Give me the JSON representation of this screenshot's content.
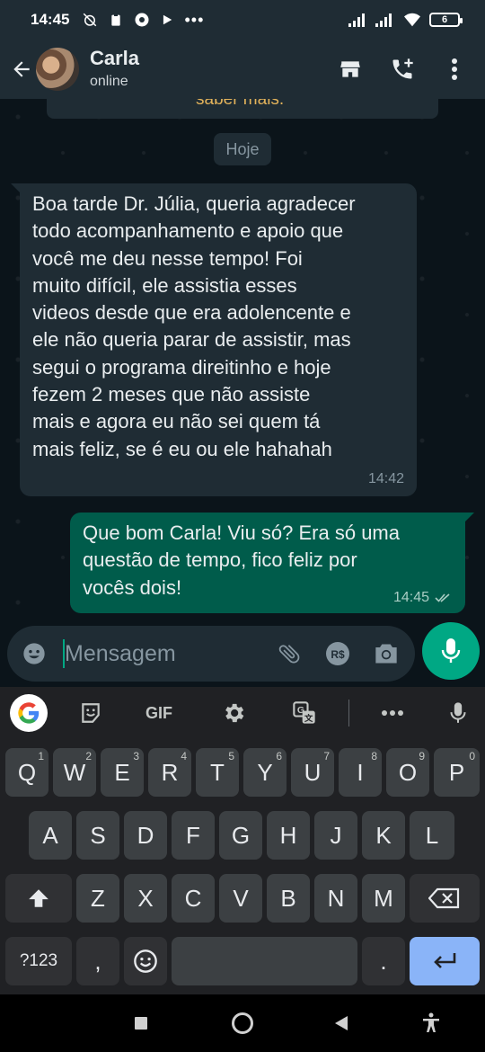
{
  "status_bar": {
    "time": "14:45",
    "battery": "6"
  },
  "header": {
    "contact_name": "Carla",
    "contact_status": "online"
  },
  "chat": {
    "previous_message_fragment": "saber mais.",
    "date_chip": "Hoje",
    "messages": [
      {
        "direction": "incoming",
        "lines": [
          "Boa tarde Dr. Júlia, queria agradecer",
          "todo acompanhamento e apoio que",
          "você me deu nesse tempo! Foi",
          "muito difícil, ele assistia esses",
          "videos desde que era adolencente e",
          "ele não queria parar de assistir, mas",
          "segui o programa direitinho e hoje",
          "fezem 2 meses que não assiste",
          "mais e agora eu não sei quem tá",
          "mais feliz, se é eu ou ele hahahah"
        ],
        "time": "14:42"
      },
      {
        "direction": "outgoing",
        "lines": [
          "Que bom Carla! Viu só? Era só uma",
          "questão de tempo, fico feliz por",
          "vocês dois!"
        ],
        "time": "14:45",
        "status": "read"
      }
    ]
  },
  "composer": {
    "placeholder": "Mensagem",
    "value": ""
  },
  "keyboard": {
    "toolbar": {
      "gif_label": "GIF"
    },
    "row1": [
      {
        "key": "Q",
        "hint": "1"
      },
      {
        "key": "W",
        "hint": "2"
      },
      {
        "key": "E",
        "hint": "3"
      },
      {
        "key": "R",
        "hint": "4"
      },
      {
        "key": "T",
        "hint": "5"
      },
      {
        "key": "Y",
        "hint": "6"
      },
      {
        "key": "U",
        "hint": "7"
      },
      {
        "key": "I",
        "hint": "8"
      },
      {
        "key": "O",
        "hint": "9"
      },
      {
        "key": "P",
        "hint": "0"
      }
    ],
    "row2": [
      "A",
      "S",
      "D",
      "F",
      "G",
      "H",
      "J",
      "K",
      "L"
    ],
    "row3": [
      "Z",
      "X",
      "C",
      "V",
      "B",
      "N",
      "M"
    ],
    "row4": {
      "symbols_label": "?123",
      "comma": ",",
      "period": "."
    }
  },
  "colors": {
    "accent": "#00a884",
    "outgoing_bubble": "#005c4b",
    "incoming_bubble": "#1f2c34",
    "background": "#0b141a",
    "keyboard_enter": "#8ab4f8"
  },
  "icons": {
    "header": [
      "arrow-back-icon",
      "catalog-store-icon",
      "add-call-icon",
      "more-vert-icon"
    ],
    "composer": [
      "emoji-icon",
      "attach-icon",
      "payment-rs-icon",
      "camera-icon",
      "mic-icon"
    ],
    "nav": [
      "recents-square-icon",
      "home-circle-icon",
      "back-triangle-icon",
      "accessibility-icon"
    ]
  }
}
